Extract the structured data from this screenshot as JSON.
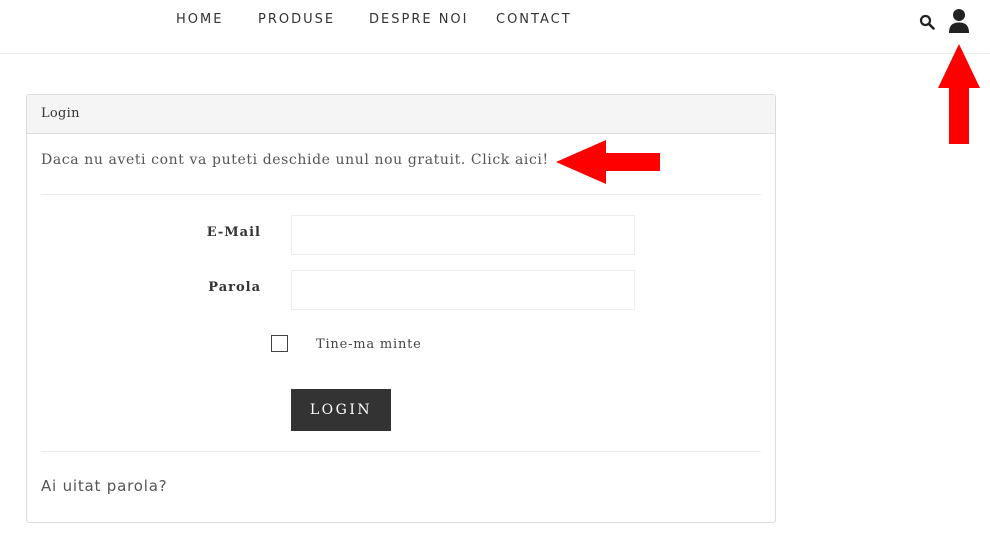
{
  "nav": {
    "home": "HOME",
    "produse": "PRODUSE",
    "despre": "DESPRE NOI",
    "contact": "CONTACT"
  },
  "header_icons": [
    "search-icon",
    "user-icon"
  ],
  "panel": {
    "heading": "Login",
    "register_text": "Daca nu aveti cont va puteti deschide unul nou gratuit. Click aici!",
    "email_label": "E-Mail",
    "email_value": "",
    "password_label": "Parola",
    "password_value": "",
    "remember_label": "Tine-ma minte",
    "remember_checked": false,
    "login_button": "LOGIN",
    "forgot_link": "Ai uitat parola?"
  },
  "colors": {
    "accent_dark": "#333333",
    "annotation_red": "#ff0000",
    "panel_heading_bg": "#f5f5f5"
  }
}
